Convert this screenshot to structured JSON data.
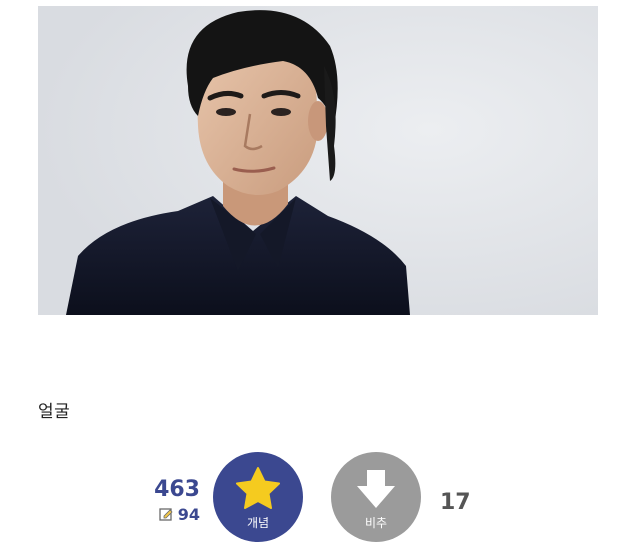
{
  "post": {
    "text": "얼굴"
  },
  "vote": {
    "up_count": "463",
    "fix_count": "94",
    "up_label": "개념",
    "down_label": "비추",
    "down_count": "17",
    "up_icon": "star-icon",
    "down_icon": "arrow-down-icon",
    "fix_icon": "pencil-edit-icon"
  },
  "colors": {
    "up_button": "#3b4890",
    "down_button": "#9b9b9b",
    "star": "#f5cb1f"
  }
}
